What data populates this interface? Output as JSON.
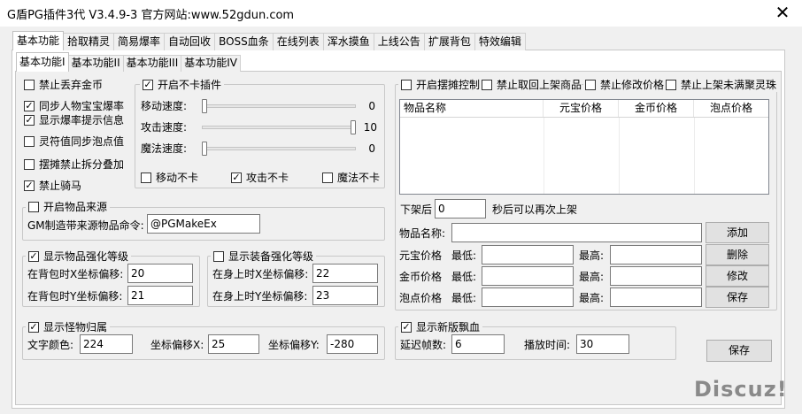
{
  "window": {
    "title": "G盾PG插件3代 V3.4.9-3   官方网站:www.52gdun.com",
    "close_glyph": "✕"
  },
  "main_tabs": [
    "基本功能",
    "拾取精灵",
    "简易爆率",
    "自动回收",
    "BOSS血条",
    "在线列表",
    "浑水摸鱼",
    "上线公告",
    "扩展背包",
    "特效编辑"
  ],
  "sub_tabs": [
    "基本功能I",
    "基本功能II",
    "基本功能III",
    "基本功能IV"
  ],
  "left_options": [
    {
      "label": "禁止丢弃金币",
      "checked": false
    },
    {
      "label": "同步人物宝宝爆率",
      "checked": true
    },
    {
      "label": "显示爆率提示信息",
      "checked": true
    },
    {
      "label": "灵符值同步泡点值",
      "checked": false
    },
    {
      "label": "摆摊禁止拆分叠加",
      "checked": false
    },
    {
      "label": "禁止骑马",
      "checked": true
    }
  ],
  "anti_lag": {
    "title": "开启不卡插件",
    "checked": true,
    "sliders": [
      {
        "label": "移动速度:",
        "value": "0",
        "fraction": 0.0
      },
      {
        "label": "攻击速度:",
        "value": "10",
        "fraction": 1.0
      },
      {
        "label": "魔法速度:",
        "value": "0",
        "fraction": 0.0
      }
    ],
    "options": [
      {
        "label": "移动不卡",
        "checked": false
      },
      {
        "label": "攻击不卡",
        "checked": true
      },
      {
        "label": "魔法不卡",
        "checked": false
      }
    ]
  },
  "item_source": {
    "title": "开启物品来源",
    "checked": false,
    "gm_label": "GM制造带来源物品命令:",
    "gm_value": "@PGMakeEx"
  },
  "item_strength": {
    "title": "显示物品强化等级",
    "checked": true,
    "x_label": "在背包时X坐标偏移:",
    "x_value": "20",
    "y_label": "在背包时Y坐标偏移:",
    "y_value": "21"
  },
  "equip_strength": {
    "title": "显示装备强化等级",
    "checked": false,
    "x_label": "在身上时X坐标偏移:",
    "x_value": "22",
    "y_label": "在身上时Y坐标偏移:",
    "y_value": "23"
  },
  "monster_owner": {
    "title": "显示怪物归属",
    "checked": true,
    "color_label": "文字颜色:",
    "color_value": "224",
    "x_label": "坐标偏移X:",
    "x_value": "25",
    "y_label": "坐标偏移Y:",
    "y_value": "-280"
  },
  "stall": {
    "options": [
      {
        "label": "开启摆摊控制",
        "checked": false
      },
      {
        "label": "禁止取回上架商品",
        "checked": false
      },
      {
        "label": "禁止修改价格",
        "checked": false
      },
      {
        "label": "禁止上架未满聚灵珠",
        "checked": false
      }
    ],
    "columns": [
      "物品名称",
      "元宝价格",
      "金币价格",
      "泡点价格"
    ],
    "relist_prefix": "下架后",
    "relist_value": "0",
    "relist_suffix": "秒后可以再次上架",
    "item_name_label": "物品名称:",
    "item_name_value": "",
    "rows": [
      {
        "label": "元宝价格",
        "min_label": "最低:",
        "max_label": "最高:"
      },
      {
        "label": "金币价格",
        "min_label": "最低:",
        "max_label": "最高:"
      },
      {
        "label": "泡点价格",
        "min_label": "最低:",
        "max_label": "最高:"
      }
    ],
    "buttons": [
      "添加",
      "删除",
      "修改",
      "保存"
    ]
  },
  "float_blood": {
    "title": "显示新版飘血",
    "checked": true,
    "delay_label": "延迟帧数:",
    "delay_value": "6",
    "play_label": "播放时间:",
    "play_value": "30"
  },
  "save_label": "保存",
  "watermark": "Discuz!",
  "check_glyph": "✓"
}
